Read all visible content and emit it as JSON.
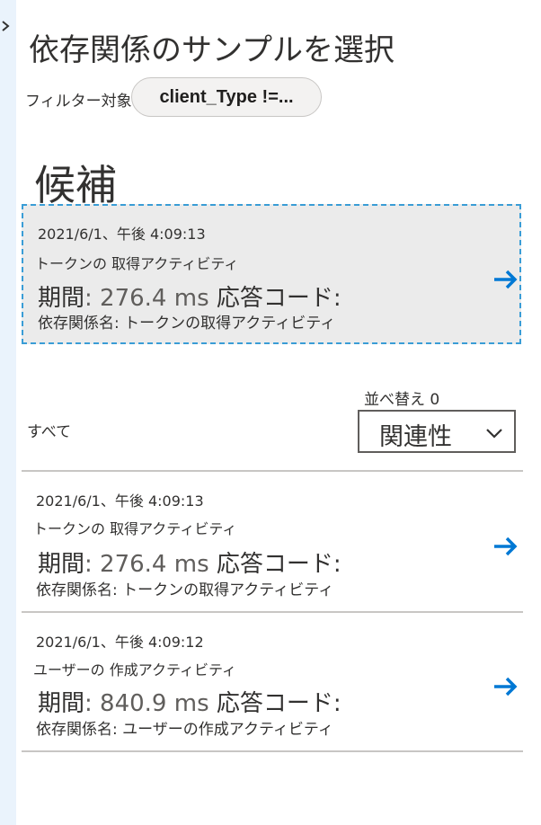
{
  "page": {
    "title": "依存関係のサンプルを選択",
    "filter_label": "フィルター対象",
    "filter_value": "client_Type !=..."
  },
  "suggested": {
    "heading": "候補",
    "item": {
      "timestamp": "2021/6/1、午後 4:09:13",
      "operation": "トークンの 取得アクティビティ",
      "duration_label": "期間",
      "duration_value": ": 276.4 ms",
      "response_code_label": "応答コード:",
      "dependency_name": "依存関係名: トークンの取得アクティビティ"
    }
  },
  "list": {
    "all_label": "すべて",
    "sort_label": "並べ替え 0",
    "sort_value": "関連性",
    "items": [
      {
        "timestamp": "2021/6/1、午後 4:09:13",
        "operation": "トークンの 取得アクティビティ",
        "duration_label": "期間",
        "duration_value": ": 276.4 ms",
        "response_code_label": "応答コード:",
        "dependency_name": "依存関係名: トークンの取得アクティビティ"
      },
      {
        "timestamp": "2021/6/1、午後 4:09:12",
        "operation": "ユーザーの 作成アクティビティ",
        "duration_label": "期間",
        "duration_value": ": 840.9 ms",
        "response_code_label": "応答コード:",
        "dependency_name": "依存関係名: ユーザーの作成アクティビティ"
      }
    ]
  },
  "icons": {
    "expand": "chevron-right-icon",
    "open": "arrow-right-icon",
    "sort": "chevron-down-icon"
  },
  "colors": {
    "accent": "#0078d4",
    "selected_border": "#3a9dd6",
    "selected_bg": "#ebebeb",
    "rail": "#eaf3fc"
  }
}
